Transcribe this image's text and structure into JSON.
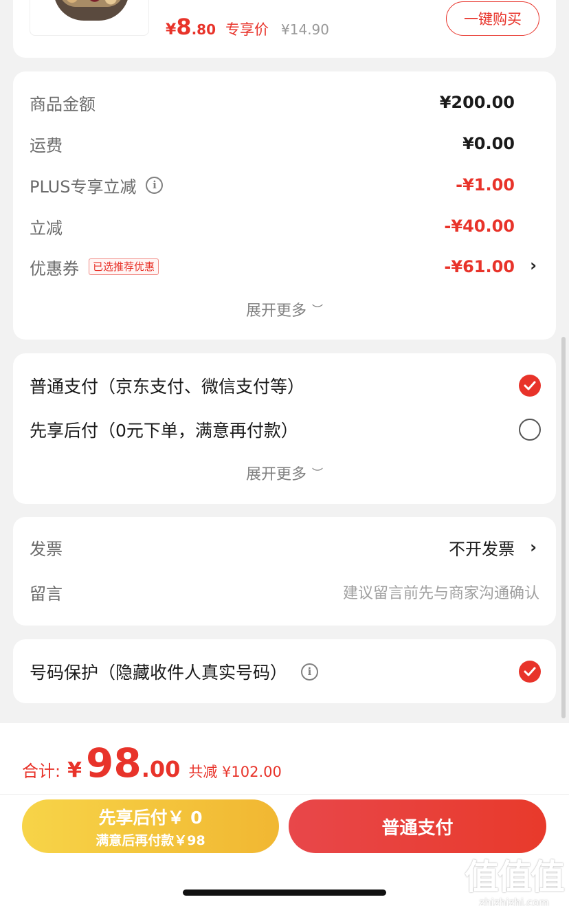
{
  "product": {
    "price_yen": "¥",
    "price_int": "8",
    "price_dec": ".80",
    "price_tag": "专享价",
    "original_price": "¥14.90",
    "buy_button": "一键购买"
  },
  "amounts": {
    "rows": [
      {
        "label": "商品金额",
        "value": "¥200.00"
      },
      {
        "label": "运费",
        "value": "¥0.00"
      },
      {
        "label": "PLUS专享立减",
        "value": "-¥1.00"
      },
      {
        "label": "立减",
        "value": "-¥40.00"
      },
      {
        "label": "优惠券",
        "badge": "已选推荐优惠",
        "value": "-¥61.00"
      }
    ],
    "expand_more": "展开更多"
  },
  "payment": {
    "options": [
      {
        "label": "普通支付（京东支付、微信支付等）",
        "selected": true
      },
      {
        "label": "先享后付（0元下单，满意再付款）",
        "selected": false
      }
    ],
    "expand_more": "展开更多"
  },
  "invoice": {
    "label": "发票",
    "value": "不开发票",
    "note_label": "留言",
    "note_placeholder": "建议留言前先与商家沟通确认"
  },
  "protection": {
    "label": "号码保护（隐藏收件人真实号码）",
    "checked": true
  },
  "bottom": {
    "total_label": "合计:",
    "total_yen": "¥",
    "total_int": "98",
    "total_dec": ".00",
    "total_saved": "共减 ¥102.00",
    "later_line1": "先享后付￥ 0",
    "later_line2": "满意后再付款￥98",
    "pay_button": "普通支付"
  },
  "watermark": {
    "mark": "值值值",
    "site": "zhizhizhi.com"
  },
  "colors": {
    "accent": "#e8332a",
    "later_button": "#f3c23a",
    "background": "#f2f2f2"
  }
}
